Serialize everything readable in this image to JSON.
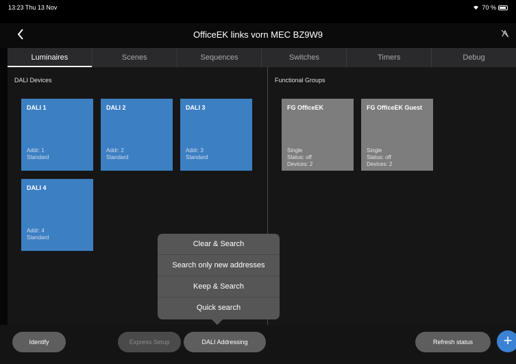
{
  "status_bar": {
    "time": "13:23  Thu 13 Nov",
    "battery": "70 %"
  },
  "nav": {
    "title": "OfficeEK links vorn MEC BZ9W9",
    "back_icon": "chevron-left-icon",
    "right_icon": "signal-off-icon"
  },
  "tabs": [
    "Luminaires",
    "Scenes",
    "Sequences",
    "Switches",
    "Timers",
    "Debug"
  ],
  "left_panel": {
    "label": "DALI Devices",
    "devices": [
      {
        "name": "DALI 1",
        "addr": "Addr: 1",
        "type": "Standard"
      },
      {
        "name": "DALI 2",
        "addr": "Addr: 2",
        "type": "Standard"
      },
      {
        "name": "DALI 3",
        "addr": "Addr: 3",
        "type": "Standard"
      },
      {
        "name": "DALI 4",
        "addr": "Addr: 4",
        "type": "Standard"
      }
    ]
  },
  "right_panel": {
    "label": "Functional Groups",
    "groups": [
      {
        "name": "FG OfficeEK",
        "mode": "Single",
        "status": "Status: off",
        "devices": "Devices: 2"
      },
      {
        "name": "FG OfficeEK Guest",
        "mode": "Single",
        "status": "Status: off",
        "devices": "Devices: 2"
      }
    ]
  },
  "popup_menu": [
    "Clear & Search",
    "Search only new addresses",
    "Keep & Search",
    "Quick search"
  ],
  "bottom_bar": {
    "identify": "Identify",
    "express_setup": "Express Setup",
    "dali_addressing": "DALI Addressing",
    "refresh_status": "Refresh status",
    "add": "+"
  },
  "colors": {
    "device_tile": "#3d7fc3",
    "group_tile": "#7d7d7d",
    "accent": "#3a82d4"
  }
}
